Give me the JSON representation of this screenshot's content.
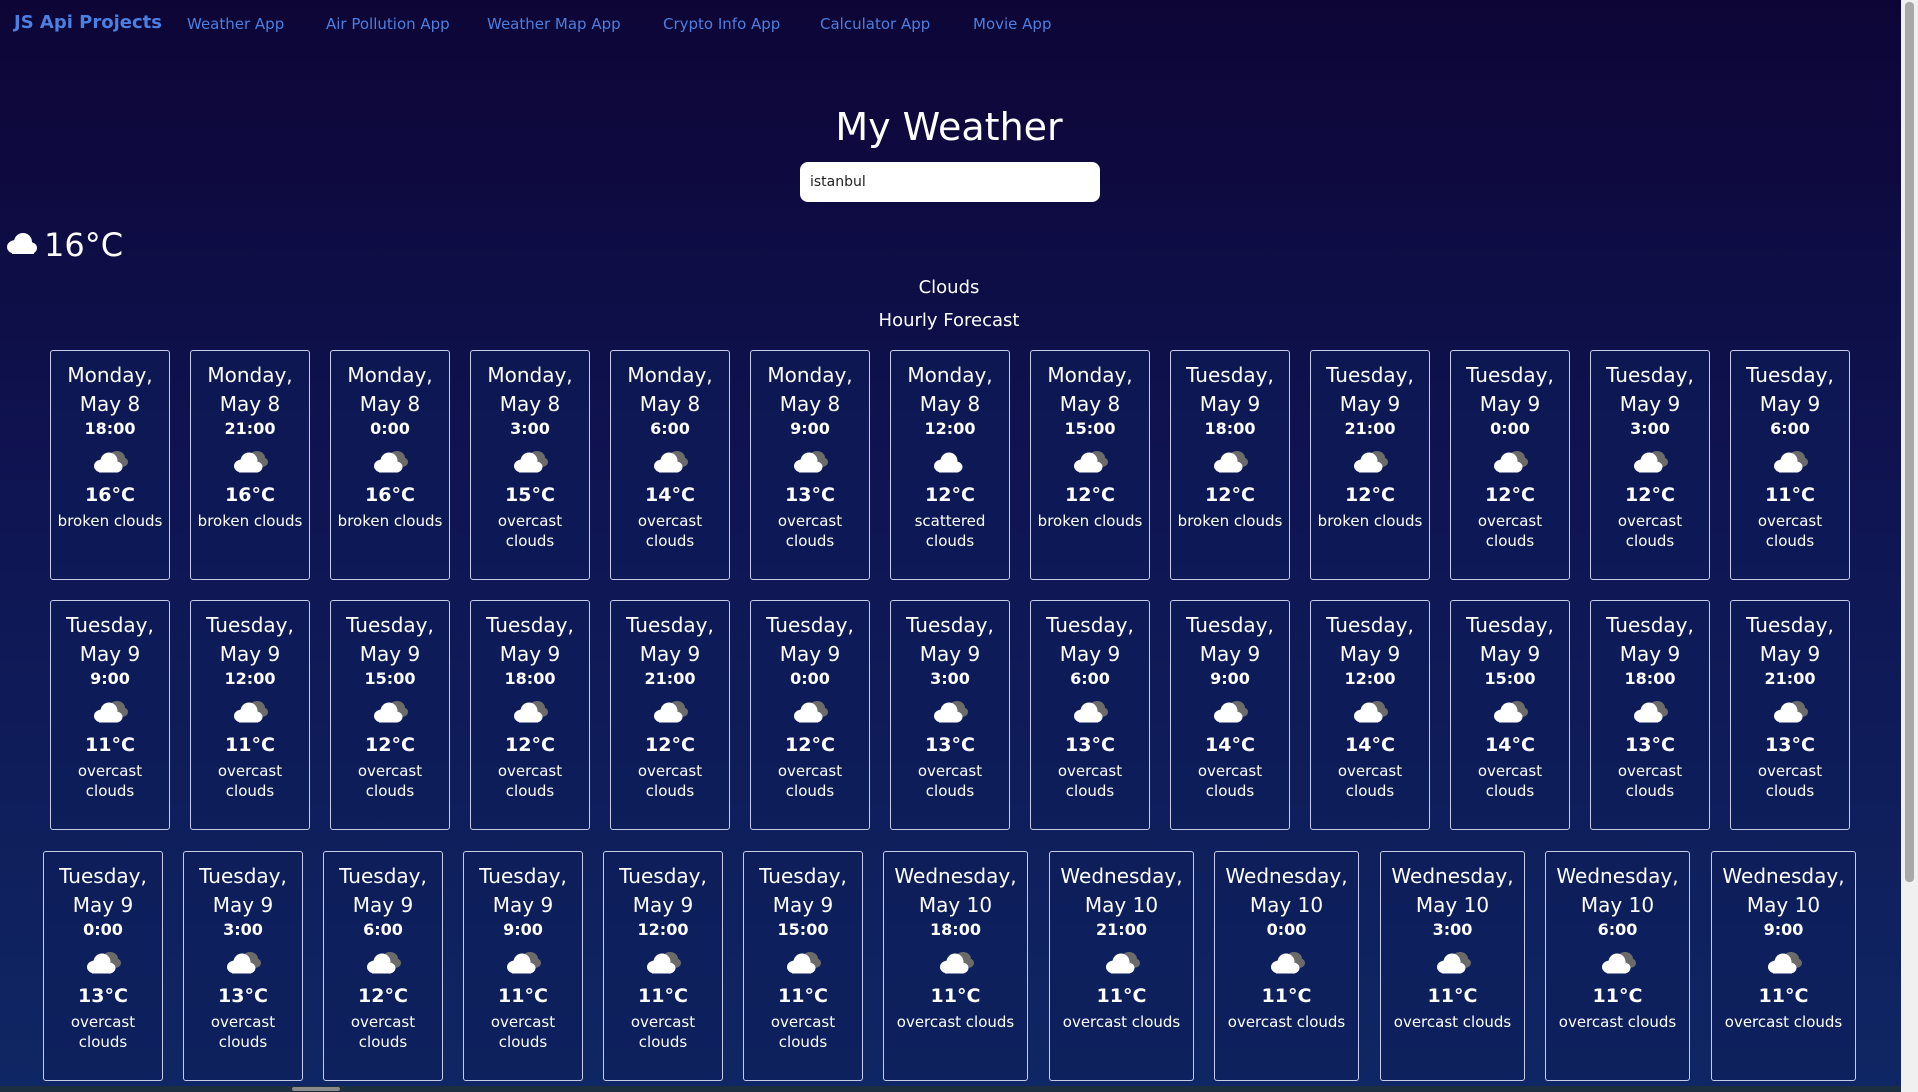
{
  "nav": {
    "brand": "JS Api Projects",
    "links": [
      "Weather App",
      "Air Pollution App",
      "Weather Map App",
      "Crypto Info App",
      "Calculator App",
      "Movie App"
    ]
  },
  "page": {
    "title": "My Weather",
    "search_value": "istanbul",
    "current_temp": "16°C",
    "current_icon": "cloud-icon",
    "current_desc": "Clouds",
    "hourly_title": "Hourly Forecast"
  },
  "colors": {
    "link": "#4d7fe0",
    "bg_top": "#0d0536",
    "bg_bottom": "#0f2764"
  },
  "forecast": [
    {
      "day": "Monday,",
      "date": "May 8",
      "time": "18:00",
      "temp": "16°C",
      "desc": "broken clouds",
      "icon": "broken-clouds-icon"
    },
    {
      "day": "Monday,",
      "date": "May 8",
      "time": "21:00",
      "temp": "16°C",
      "desc": "broken clouds",
      "icon": "broken-clouds-icon"
    },
    {
      "day": "Monday,",
      "date": "May 8",
      "time": "0:00",
      "temp": "16°C",
      "desc": "broken clouds",
      "icon": "broken-clouds-icon"
    },
    {
      "day": "Monday,",
      "date": "May 8",
      "time": "3:00",
      "temp": "15°C",
      "desc": "overcast clouds",
      "icon": "overcast-clouds-icon"
    },
    {
      "day": "Monday,",
      "date": "May 8",
      "time": "6:00",
      "temp": "14°C",
      "desc": "overcast clouds",
      "icon": "overcast-clouds-icon"
    },
    {
      "day": "Monday,",
      "date": "May 8",
      "time": "9:00",
      "temp": "13°C",
      "desc": "overcast clouds",
      "icon": "overcast-clouds-icon"
    },
    {
      "day": "Monday,",
      "date": "May 8",
      "time": "12:00",
      "temp": "12°C",
      "desc": "scattered clouds",
      "icon": "scattered-clouds-icon"
    },
    {
      "day": "Monday,",
      "date": "May 8",
      "time": "15:00",
      "temp": "12°C",
      "desc": "broken clouds",
      "icon": "broken-clouds-icon"
    },
    {
      "day": "Tuesday,",
      "date": "May 9",
      "time": "18:00",
      "temp": "12°C",
      "desc": "broken clouds",
      "icon": "broken-clouds-icon"
    },
    {
      "day": "Tuesday,",
      "date": "May 9",
      "time": "21:00",
      "temp": "12°C",
      "desc": "broken clouds",
      "icon": "broken-clouds-icon"
    },
    {
      "day": "Tuesday,",
      "date": "May 9",
      "time": "0:00",
      "temp": "12°C",
      "desc": "overcast clouds",
      "icon": "overcast-clouds-icon"
    },
    {
      "day": "Tuesday,",
      "date": "May 9",
      "time": "3:00",
      "temp": "12°C",
      "desc": "overcast clouds",
      "icon": "overcast-clouds-icon"
    },
    {
      "day": "Tuesday,",
      "date": "May 9",
      "time": "6:00",
      "temp": "11°C",
      "desc": "overcast clouds",
      "icon": "overcast-clouds-icon"
    },
    {
      "day": "Tuesday,",
      "date": "May 9",
      "time": "9:00",
      "temp": "11°C",
      "desc": "overcast clouds",
      "icon": "overcast-clouds-icon"
    },
    {
      "day": "Tuesday,",
      "date": "May 9",
      "time": "12:00",
      "temp": "11°C",
      "desc": "overcast clouds",
      "icon": "overcast-clouds-icon"
    },
    {
      "day": "Tuesday,",
      "date": "May 9",
      "time": "15:00",
      "temp": "12°C",
      "desc": "overcast clouds",
      "icon": "overcast-clouds-icon"
    },
    {
      "day": "Tuesday,",
      "date": "May 9",
      "time": "18:00",
      "temp": "12°C",
      "desc": "overcast clouds",
      "icon": "overcast-clouds-icon"
    },
    {
      "day": "Tuesday,",
      "date": "May 9",
      "time": "21:00",
      "temp": "12°C",
      "desc": "overcast clouds",
      "icon": "overcast-clouds-icon"
    },
    {
      "day": "Tuesday,",
      "date": "May 9",
      "time": "0:00",
      "temp": "12°C",
      "desc": "overcast clouds",
      "icon": "overcast-clouds-icon"
    },
    {
      "day": "Tuesday,",
      "date": "May 9",
      "time": "3:00",
      "temp": "13°C",
      "desc": "overcast clouds",
      "icon": "overcast-clouds-icon"
    },
    {
      "day": "Tuesday,",
      "date": "May 9",
      "time": "6:00",
      "temp": "13°C",
      "desc": "overcast clouds",
      "icon": "overcast-clouds-icon"
    },
    {
      "day": "Tuesday,",
      "date": "May 9",
      "time": "9:00",
      "temp": "14°C",
      "desc": "overcast clouds",
      "icon": "overcast-clouds-icon"
    },
    {
      "day": "Tuesday,",
      "date": "May 9",
      "time": "12:00",
      "temp": "14°C",
      "desc": "overcast clouds",
      "icon": "overcast-clouds-icon"
    },
    {
      "day": "Tuesday,",
      "date": "May 9",
      "time": "15:00",
      "temp": "14°C",
      "desc": "overcast clouds",
      "icon": "overcast-clouds-icon"
    },
    {
      "day": "Tuesday,",
      "date": "May 9",
      "time": "18:00",
      "temp": "13°C",
      "desc": "overcast clouds",
      "icon": "overcast-clouds-icon"
    },
    {
      "day": "Tuesday,",
      "date": "May 9",
      "time": "21:00",
      "temp": "13°C",
      "desc": "overcast clouds",
      "icon": "overcast-clouds-icon"
    },
    {
      "day": "Tuesday,",
      "date": "May 9",
      "time": "0:00",
      "temp": "13°C",
      "desc": "overcast clouds",
      "icon": "overcast-clouds-icon"
    },
    {
      "day": "Tuesday,",
      "date": "May 9",
      "time": "3:00",
      "temp": "13°C",
      "desc": "overcast clouds",
      "icon": "overcast-clouds-icon"
    },
    {
      "day": "Tuesday,",
      "date": "May 9",
      "time": "6:00",
      "temp": "12°C",
      "desc": "overcast clouds",
      "icon": "overcast-clouds-icon"
    },
    {
      "day": "Tuesday,",
      "date": "May 9",
      "time": "9:00",
      "temp": "11°C",
      "desc": "overcast clouds",
      "icon": "overcast-clouds-icon"
    },
    {
      "day": "Tuesday,",
      "date": "May 9",
      "time": "12:00",
      "temp": "11°C",
      "desc": "overcast clouds",
      "icon": "overcast-clouds-icon"
    },
    {
      "day": "Tuesday,",
      "date": "May 9",
      "time": "15:00",
      "temp": "11°C",
      "desc": "overcast clouds",
      "icon": "overcast-clouds-icon"
    },
    {
      "day": "Wednesday,",
      "date": "May 10",
      "time": "18:00",
      "temp": "11°C",
      "desc": "overcast clouds",
      "icon": "overcast-clouds-icon"
    },
    {
      "day": "Wednesday,",
      "date": "May 10",
      "time": "21:00",
      "temp": "11°C",
      "desc": "overcast clouds",
      "icon": "overcast-clouds-icon"
    },
    {
      "day": "Wednesday,",
      "date": "May 10",
      "time": "0:00",
      "temp": "11°C",
      "desc": "overcast clouds",
      "icon": "overcast-clouds-icon"
    },
    {
      "day": "Wednesday,",
      "date": "May 10",
      "time": "3:00",
      "temp": "11°C",
      "desc": "overcast clouds",
      "icon": "overcast-clouds-icon"
    },
    {
      "day": "Wednesday,",
      "date": "May 10",
      "time": "6:00",
      "temp": "11°C",
      "desc": "overcast clouds",
      "icon": "overcast-clouds-icon"
    },
    {
      "day": "Wednesday,",
      "date": "May 10",
      "time": "9:00",
      "temp": "11°C",
      "desc": "overcast clouds",
      "icon": "overcast-clouds-icon"
    }
  ]
}
